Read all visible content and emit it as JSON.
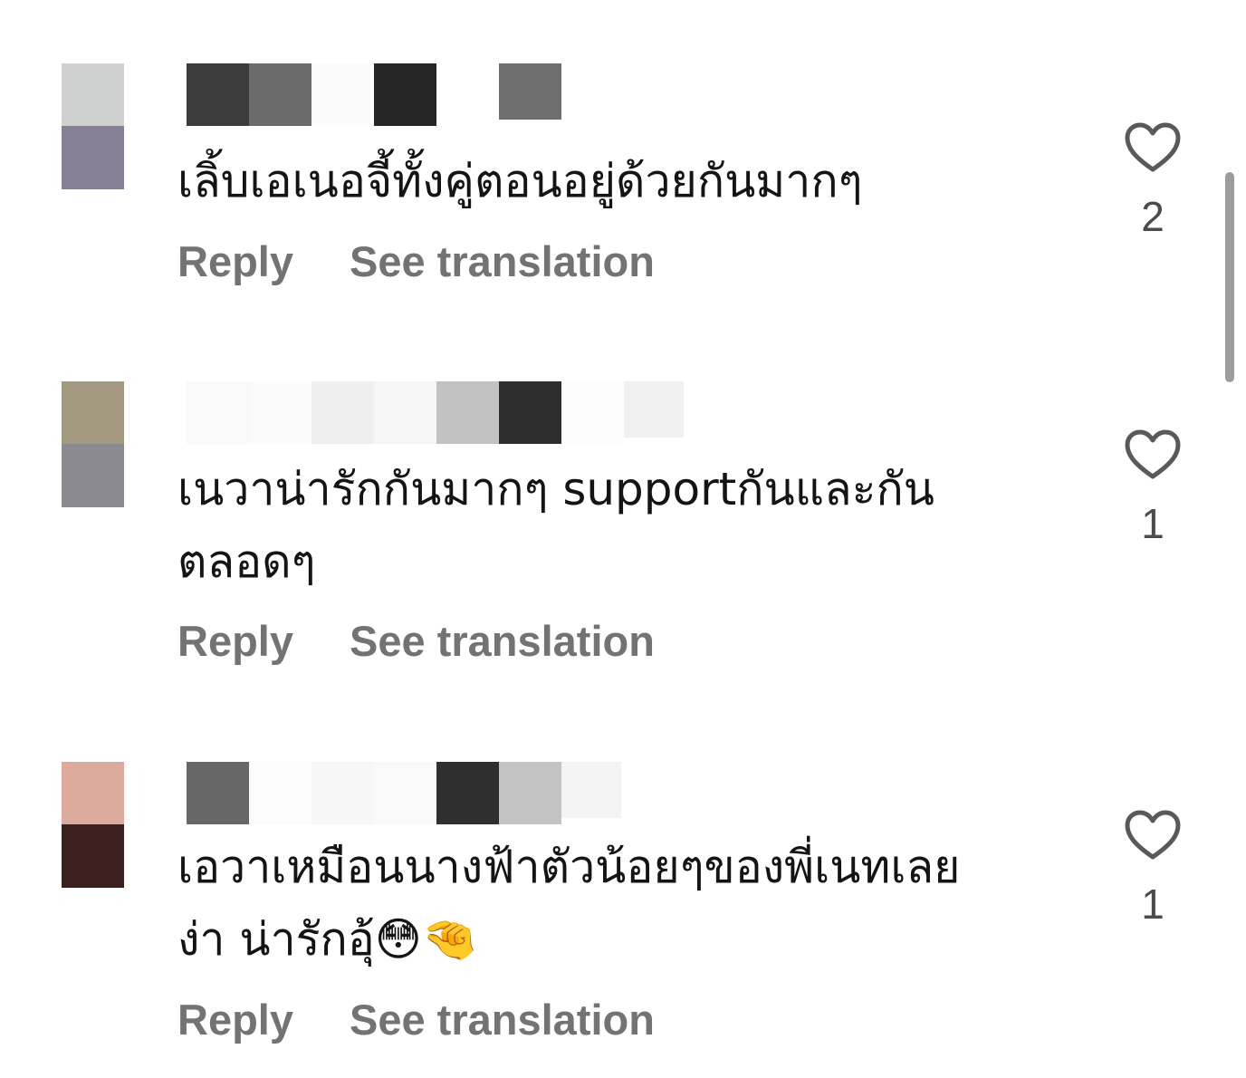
{
  "comments": [
    {
      "text": "เลิ้บเอเนอจี้ทั้งคู่ตอนอยู่ด้วยกันมากๆ",
      "reply_label": "Reply",
      "translate_label": "See translation",
      "likes": "2",
      "avatar_colors": [
        "#cfd1d0",
        "#878094"
      ]
    },
    {
      "text": "เนวาน่ารักกันมากๆ supportกันและกัน\nตลอดๆ",
      "reply_label": "Reply",
      "translate_label": "See translation",
      "likes": "1",
      "avatar_colors": [
        "#a49a82",
        "#8b8a90"
      ]
    },
    {
      "text": "เอวาเหมือนนางฟ้าตัวน้อยๆของพี่เนทเลย\nง่า น่ารักอุ้😳🤏",
      "reply_label": "Reply",
      "translate_label": "See translation",
      "likes": "1",
      "avatar_colors": [
        "#dcab9d",
        "#3a1f1c"
      ]
    }
  ],
  "colors": {
    "text": "#141414",
    "action": "#737373",
    "count": "#4b4b4b",
    "heart": "#595959",
    "scrollbar": "#9c9c9c"
  },
  "icons": {
    "like": "heart-outline-icon"
  }
}
